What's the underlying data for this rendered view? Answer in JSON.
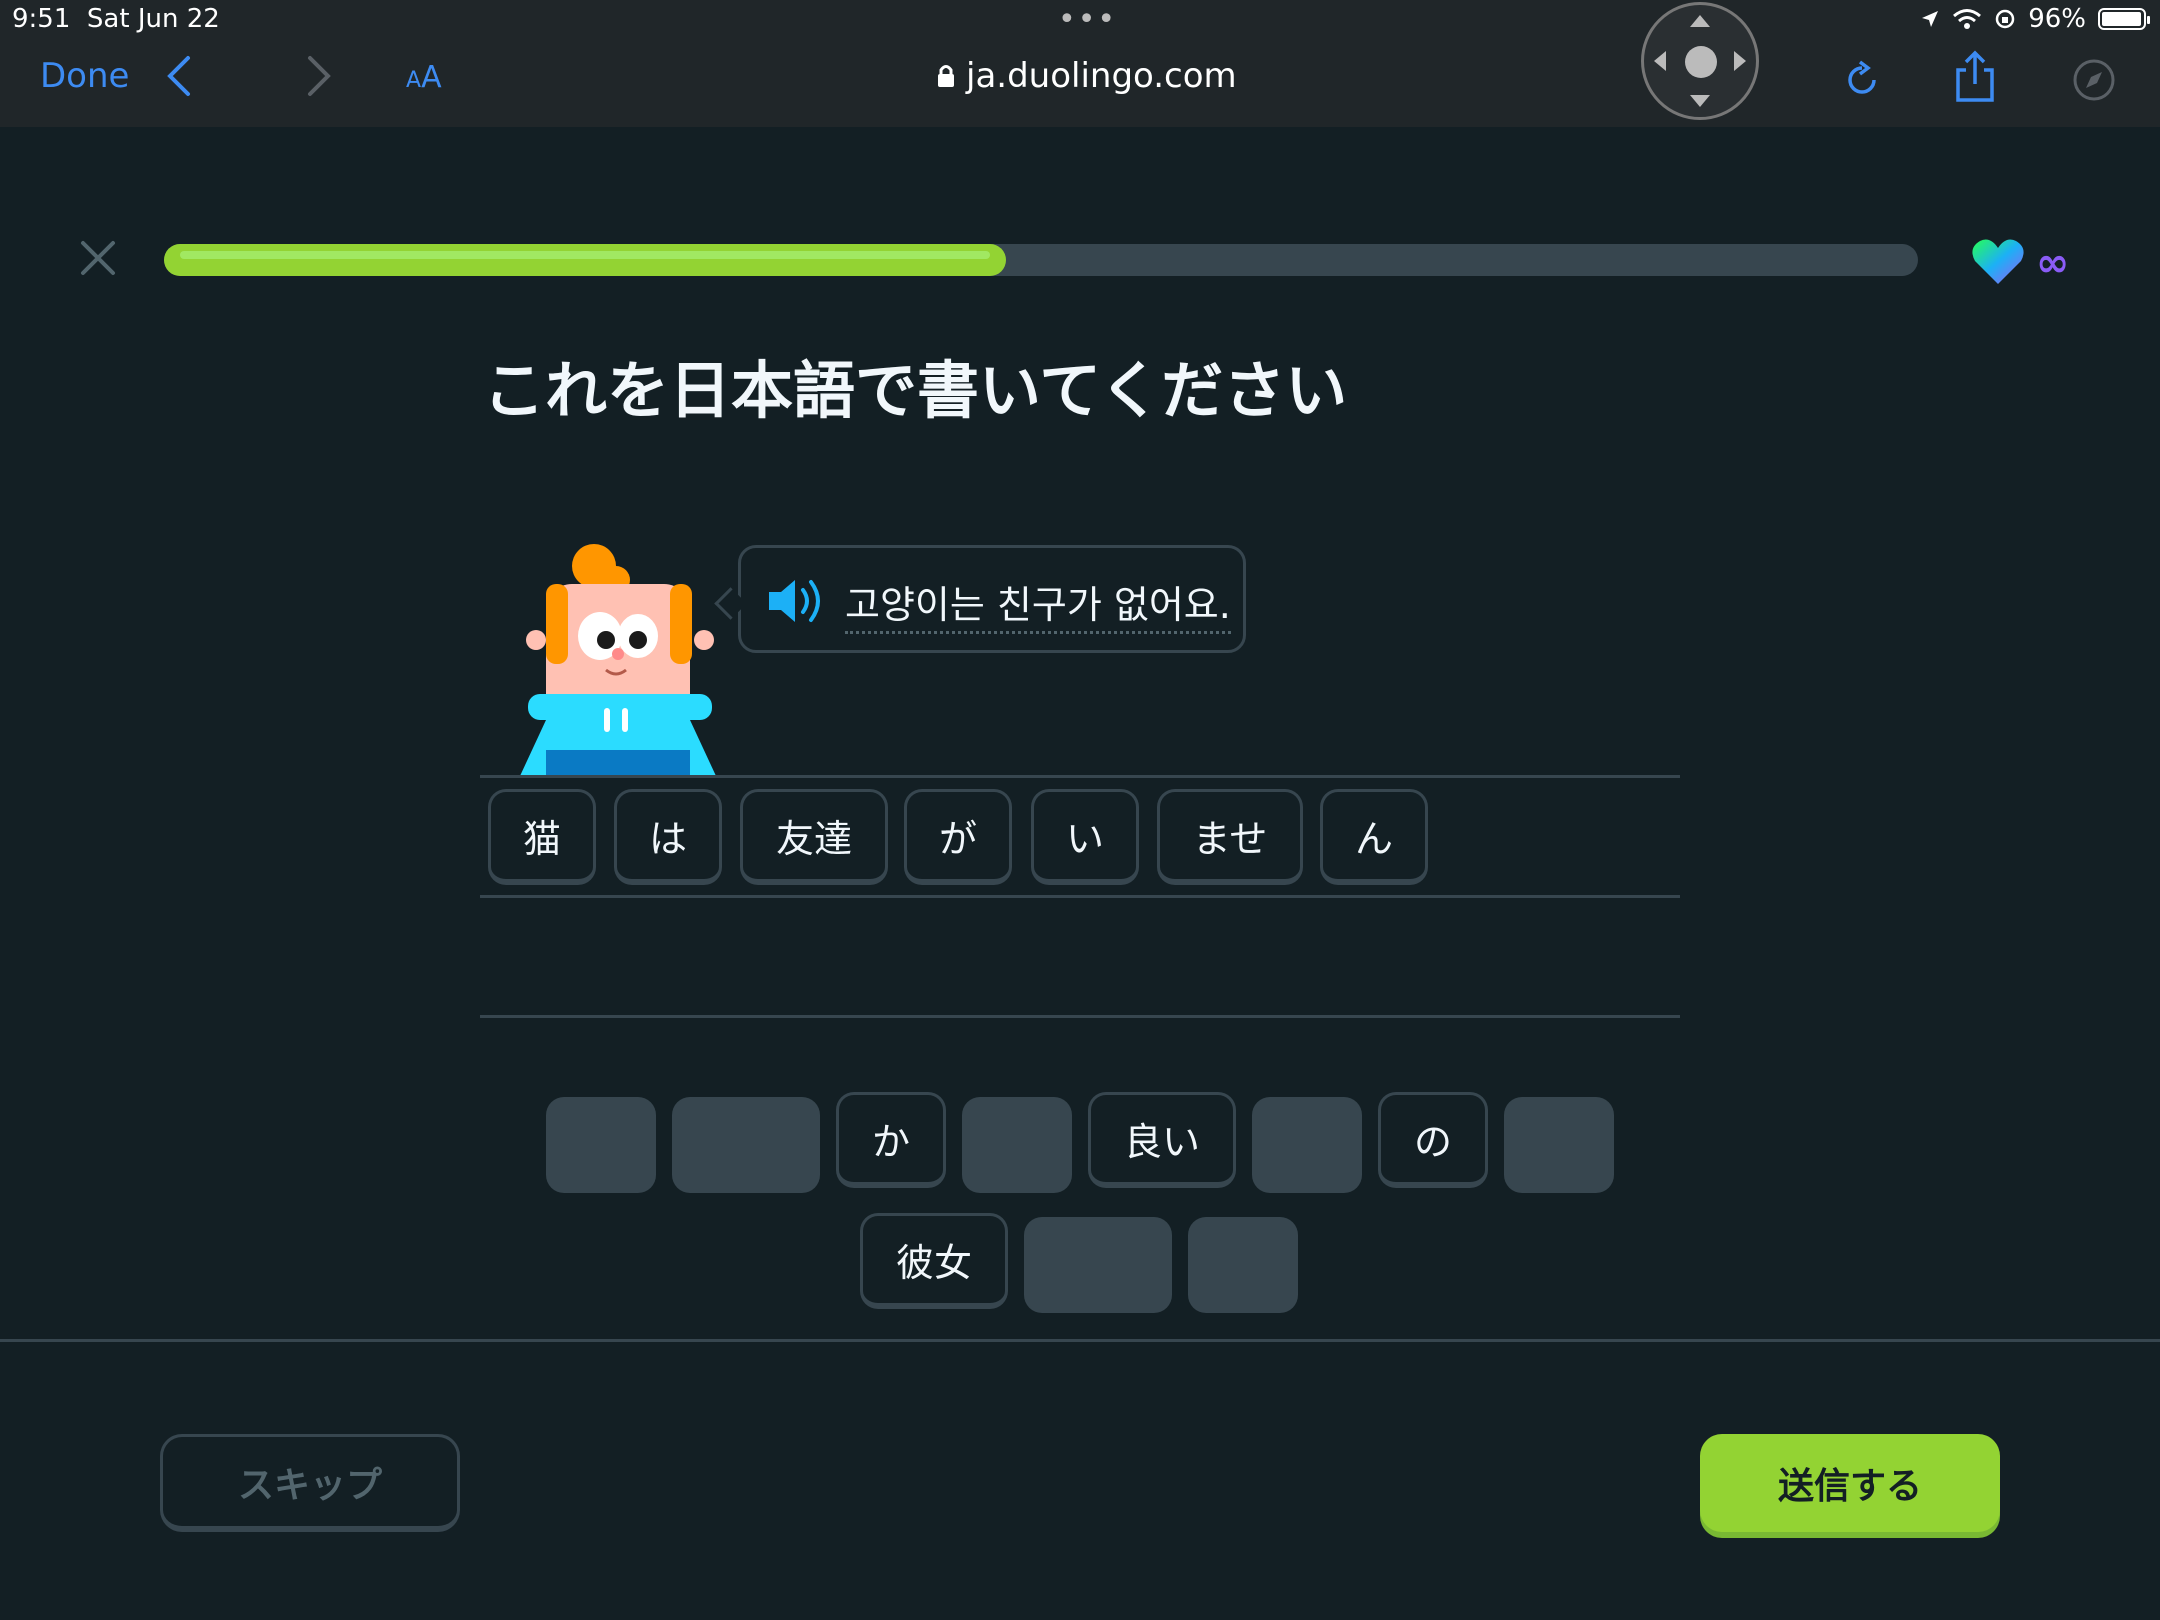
{
  "status_bar": {
    "time": "9:51",
    "date": "Sat Jun 22",
    "battery": "96%"
  },
  "browser": {
    "done_label": "Done",
    "text_size_label_small": "A",
    "text_size_label_large": "A",
    "url": "ja.duolingo.com"
  },
  "lesson": {
    "progress_fraction": 0.48,
    "hearts": "∞",
    "title": "これを日本語で書いてください",
    "prompt": "고양이는 친구가 없어요.",
    "answer_tiles": [
      "猫",
      "は",
      "友達",
      "が",
      "い",
      "ませ",
      "ん"
    ],
    "bank_row1": [
      {
        "text": "",
        "used": true
      },
      {
        "text": "",
        "used": true
      },
      {
        "text": "か",
        "used": false
      },
      {
        "text": "",
        "used": true
      },
      {
        "text": "良い",
        "used": false
      },
      {
        "text": "",
        "used": true
      },
      {
        "text": "の",
        "used": false
      },
      {
        "text": "",
        "used": true
      }
    ],
    "bank_row2": [
      {
        "text": "彼女",
        "used": false
      },
      {
        "text": "",
        "used": true
      },
      {
        "text": "",
        "used": true
      }
    ]
  },
  "footer": {
    "skip_label": "スキップ",
    "submit_label": "送信する"
  },
  "colors": {
    "background": "#131f24",
    "accent_green": "#93d333",
    "link_blue": "#3d8bf2",
    "border": "#37464f"
  }
}
